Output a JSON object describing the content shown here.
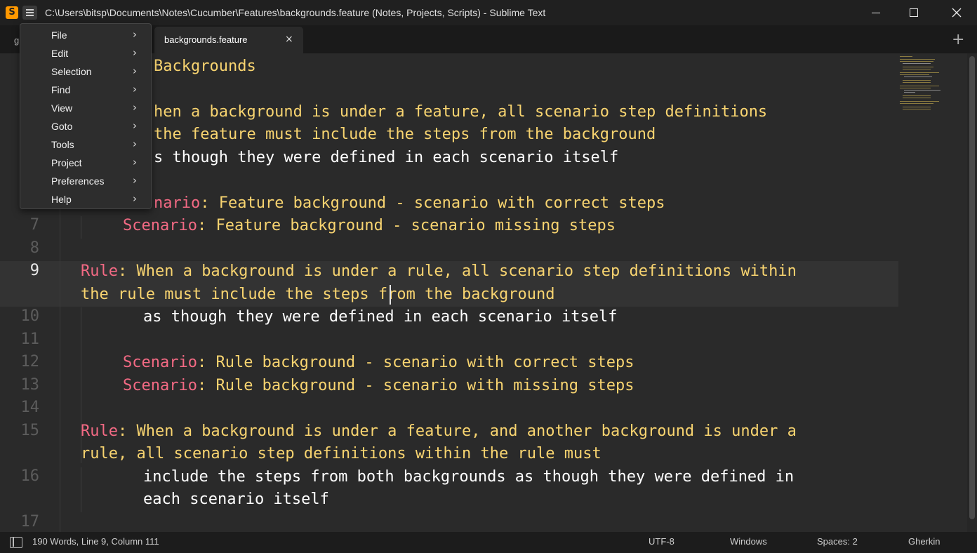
{
  "window": {
    "title": "C:\\Users\\bitsp\\Documents\\Notes\\Cucumber\\Features\\backgrounds.feature (Notes, Projects, Scripts) - Sublime Text",
    "app_icon": "S"
  },
  "tabs": {
    "prev_label": "g",
    "active_label": "backgrounds.feature",
    "close_glyph": "×",
    "add_glyph": "+"
  },
  "menu": {
    "items": [
      {
        "label": "File"
      },
      {
        "label": "Edit"
      },
      {
        "label": "Selection"
      },
      {
        "label": "Find"
      },
      {
        "label": "View"
      },
      {
        "label": "Goto"
      },
      {
        "label": "Tools"
      },
      {
        "label": "Project"
      },
      {
        "label": "Preferences"
      },
      {
        "label": "Help"
      }
    ],
    "arrow_glyph": "›"
  },
  "editor": {
    "line_numbers": [
      "7",
      "8",
      "9",
      "10",
      "11",
      "12",
      "13",
      "14",
      "15",
      "16",
      "17"
    ],
    "current_line": "9",
    "lines": {
      "l1_text": "Backgrounds",
      "l3_text": "hen a background is under a feature, all scenario step definitions",
      "l3b_text": "the feature must include the steps from the background",
      "l4_text": "s though they were defined in each scenario itself",
      "l6_kw": "nario",
      "l6_text": ": Feature background - scenario with correct steps",
      "l7_kw": "Scenario",
      "l7_text": ": Feature background - scenario missing steps",
      "l9_kw": "Rule",
      "l9_text": ": When a background is under a rule, all scenario step definitions within",
      "l9b_text": "the rule must include the steps from the background",
      "l10_text": "as though they were defined in each scenario itself",
      "l12_kw": "Scenario",
      "l12_text": ": Rule background - scenario with correct steps",
      "l13_kw": "Scenario",
      "l13_text": ": Rule background - scenario with missing steps",
      "l15_kw": "Rule",
      "l15_text": ": When a background is under a feature, and another background is under a",
      "l15b_text": "rule, all scenario step definitions within the rule must",
      "l16_text": "include the steps from both backgrounds as though they were defined in",
      "l16b_text": "each scenario itself"
    }
  },
  "status": {
    "position": "190 Words, Line 9, Column 111",
    "encoding": "UTF-8",
    "line_endings": "Windows",
    "indentation": "Spaces: 2",
    "syntax": "Gherkin"
  },
  "colors": {
    "keyword": "#f36a84",
    "string": "#f8d470",
    "background": "#2a2a2a"
  }
}
